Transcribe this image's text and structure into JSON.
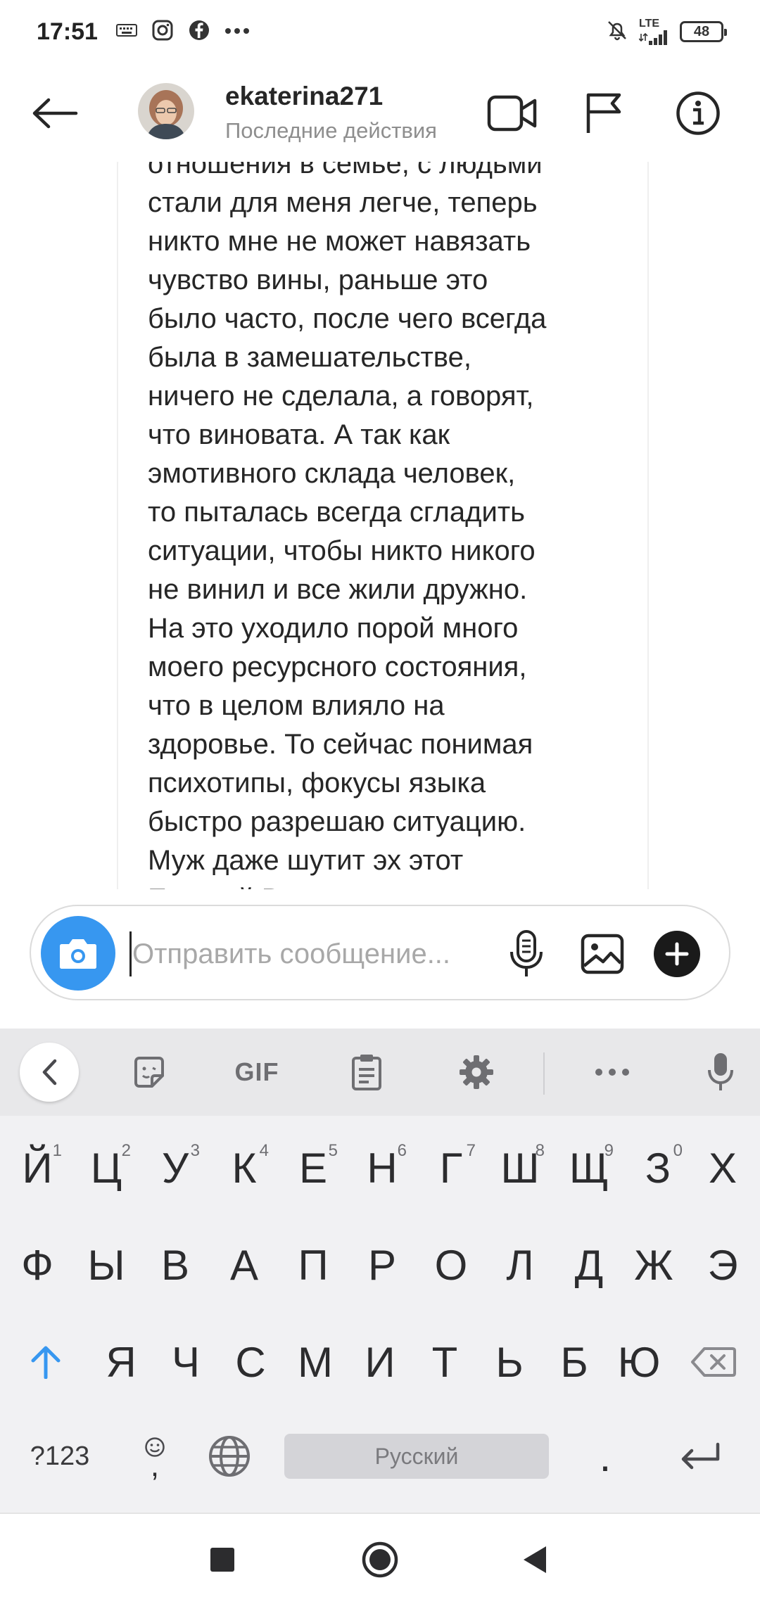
{
  "status_bar": {
    "time": "17:51",
    "network": "LTE",
    "battery": "48"
  },
  "header": {
    "username": "ekaterina271",
    "status": "Последние действия"
  },
  "message": {
    "lines": [
      "отношения в семье, с людьми",
      "стали для  меня легче, теперь",
      "никто мне не может навязать",
      "чувство вины, раньше это",
      "было часто, после чего всегда",
      "была в замешательстве,",
      "ничего не сделала, а говорят,",
      "что виновата. А так как",
      "эмотивного склада человек,",
      "то пыталась всегда сгладить",
      "ситуации, чтобы никто никого",
      "не винил и все жили дружно.",
      "На это уходило порой много",
      "моего ресурсного состояния,",
      "что в целом влияло на",
      "здоровье. То сейчас понимая",
      "психотипы, фокусы языка",
      "быстро разрешаю ситуацию.",
      "Муж даже шутит эх этот",
      "Евгений Вадимович, теперь"
    ]
  },
  "composer": {
    "placeholder": "Отправить сообщение..."
  },
  "keyboard": {
    "toolbar": {
      "gif_label": "GIF"
    },
    "row1": [
      {
        "label": "Й",
        "hint": "1"
      },
      {
        "label": "Ц",
        "hint": "2"
      },
      {
        "label": "У",
        "hint": "3"
      },
      {
        "label": "К",
        "hint": "4"
      },
      {
        "label": "Е",
        "hint": "5"
      },
      {
        "label": "Н",
        "hint": "6"
      },
      {
        "label": "Г",
        "hint": "7"
      },
      {
        "label": "Ш",
        "hint": "8"
      },
      {
        "label": "Щ",
        "hint": "9"
      },
      {
        "label": "З",
        "hint": "0"
      },
      {
        "label": "Х",
        "hint": ""
      }
    ],
    "row2": [
      "Ф",
      "Ы",
      "В",
      "А",
      "П",
      "Р",
      "О",
      "Л",
      "Д",
      "Ж",
      "Э"
    ],
    "row3": [
      "Я",
      "Ч",
      "С",
      "М",
      "И",
      "Т",
      "Ь",
      "Б",
      "Ю"
    ],
    "row4": {
      "symbols_label": "?123",
      "comma_label": ",",
      "space_label": "Русский",
      "period_label": "."
    }
  },
  "colors": {
    "accent_blue": "#3797f0",
    "text_primary": "#262626",
    "text_secondary": "#8e8e8e"
  }
}
